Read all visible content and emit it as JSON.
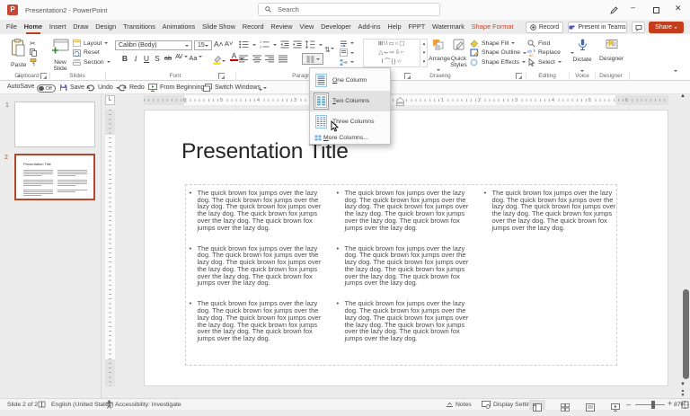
{
  "titlebar": {
    "title": "Presentation2 - PowerPoint",
    "search": "Search",
    "app_letter": "P"
  },
  "menu": {
    "tabs": [
      "File",
      "Home",
      "Insert",
      "Draw",
      "Design",
      "Transitions",
      "Animations",
      "Slide Show",
      "Record",
      "Review",
      "View",
      "Developer",
      "Add-ins",
      "Help",
      "FPPT",
      "Watermark",
      "Shape Format"
    ],
    "active_tab": "Home",
    "record": "Record",
    "teams": "Present in Teams",
    "share": "Share"
  },
  "qat": {
    "autosave": "AutoSave",
    "off": "Off",
    "save": "Save",
    "undo": "Undo",
    "redo": "Redo",
    "from_beginning": "From Beginning",
    "switch_windows": "Switch Windows"
  },
  "ribbon": {
    "paste": "Paste",
    "new_slide_1": "New",
    "new_slide_2": "Slide",
    "layout": "Layout",
    "reset": "Reset",
    "section": "Section",
    "font_name": "Calibri (Body)",
    "font_size": "15",
    "bold": "B",
    "italic": "I",
    "underline": "U",
    "shadow": "S",
    "strike": "ab",
    "char_spacing": "AV",
    "change_case": "Aa",
    "font_color": "A",
    "arrange": "Arrange",
    "quick_1": "Quick",
    "quick_2": "Styles",
    "shape_fill": "Shape Fill",
    "shape_outline": "Shape Outline",
    "shape_effects": "Shape Effects",
    "find": "Find",
    "replace": "Replace",
    "select": "Select",
    "dictate": "Dictate",
    "designer_btn": "Designer",
    "groups": {
      "clipboard": "Clipboard",
      "slides": "Slides",
      "font": "Font",
      "paragraph": "Paragraph",
      "drawing": "Drawing",
      "editing": "Editing",
      "voice": "Voice",
      "designer": "Designer"
    }
  },
  "columns_menu": {
    "one": "One Column",
    "two": "Two Columns",
    "three": "Three Columns",
    "more": "More Columns...",
    "selected": "Two Columns"
  },
  "ruler": {
    "l6": "6",
    "l5": "5",
    "l4": "4",
    "l3": "3",
    "r1": "1",
    "r2": "2",
    "r3": "3",
    "r4": "4",
    "r5": "5",
    "r6": "6"
  },
  "panel": {
    "n1": "1",
    "n2": "2",
    "thumb_title": "Presentation Title"
  },
  "slide": {
    "title": "Presentation Title",
    "bullet": "•",
    "paragraph": "The quick brown fox jumps over the lazy dog. The quick brown fox jumps over the lazy dog. The quick brown fox jumps over the lazy dog. The quick brown fox jumps over the lazy dog. The quick brown fox jumps over the lazy dog.",
    "columns_paragraph_counts": [
      3,
      3,
      1
    ]
  },
  "status": {
    "slide": "Slide 2 of 2",
    "lang": "English (United States)",
    "acc": "Accessibility: Investigate",
    "notes": "Notes",
    "display": "Display Settings",
    "zoom": "87%"
  },
  "colors": {
    "accent": "#b7472a",
    "share": "#c43e1c",
    "menu_selected_bg": "#e2e2e2"
  }
}
